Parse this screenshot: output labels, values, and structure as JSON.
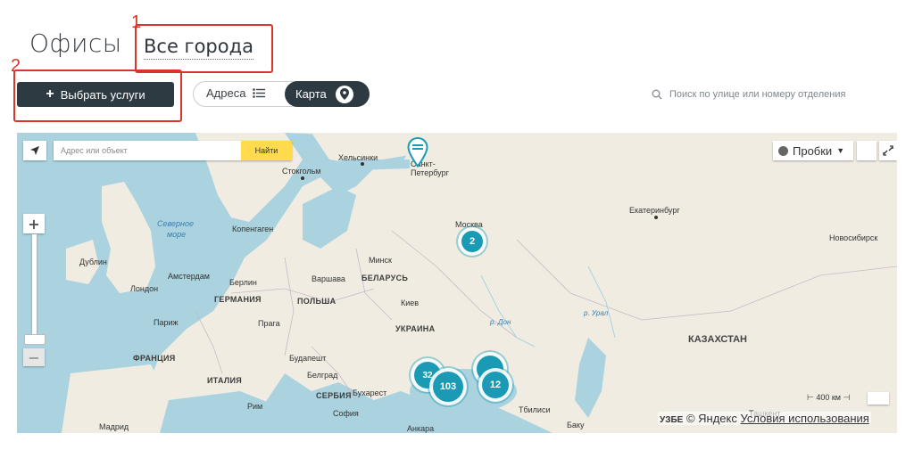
{
  "header": {
    "title": "Офисы",
    "city": "Все города",
    "callout_1": "1",
    "callout_2": "2"
  },
  "toolbar": {
    "services_button": "Выбрать услуги",
    "view_addresses": "Адреса",
    "view_map": "Карта",
    "search_placeholder": "Поиск по улице или номеру отделения"
  },
  "map": {
    "search_placeholder": "Адрес или объект",
    "find_button": "Найти",
    "traffic_label": "Пробки",
    "scale_label": "400 км",
    "copyright": "© Яндекс",
    "terms": "Условия использования",
    "edge_label": "УЗБЕ",
    "clusters": [
      "2",
      "103",
      "12",
      "32"
    ],
    "labels": {
      "helsinki": "Хельсинки",
      "stockholm": "Стокгольм",
      "spb1": "Санкт-",
      "spb2": "Петербург",
      "moscow": "Москва",
      "yekaterinburg": "Екатеринбург",
      "novosibirsk": "Новосибирск",
      "north_sea1": "Северное",
      "north_sea2": "море",
      "copenhagen": "Копенгаген",
      "dublin": "Дублин",
      "amsterdam": "Амстердам",
      "london": "Лондон",
      "berlin": "Берлин",
      "warsaw": "Варшава",
      "minsk": "Минск",
      "belarus": "БЕЛАРУСЬ",
      "germany": "ГЕРМАНИЯ",
      "poland": "ПОЛЬША",
      "kiev": "Киев",
      "ukraine": "УКРАИНА",
      "paris": "Париж",
      "prague": "Прага",
      "don": "р. Дон",
      "ural": "р. Урал",
      "kazakhstan": "КАЗАХСТАН",
      "france": "ФРАНЦИЯ",
      "budapest": "Будапешт",
      "belgrade": "Белград",
      "italy": "ИТАЛИЯ",
      "serbia": "СЕРБИЯ",
      "bucharest": "Бухарест",
      "rome": "Рим",
      "sofia": "София",
      "tbilisi": "Тбилиси",
      "baku": "Баку",
      "tashkent": "Ташкент",
      "madrid": "Мадрид",
      "ankara": "Анкара"
    }
  },
  "colors": {
    "accent_dark": "#2e3a42",
    "callout_red": "#d9362b",
    "cluster": "#1a9ab5",
    "find_yellow": "#ffdb4d"
  }
}
